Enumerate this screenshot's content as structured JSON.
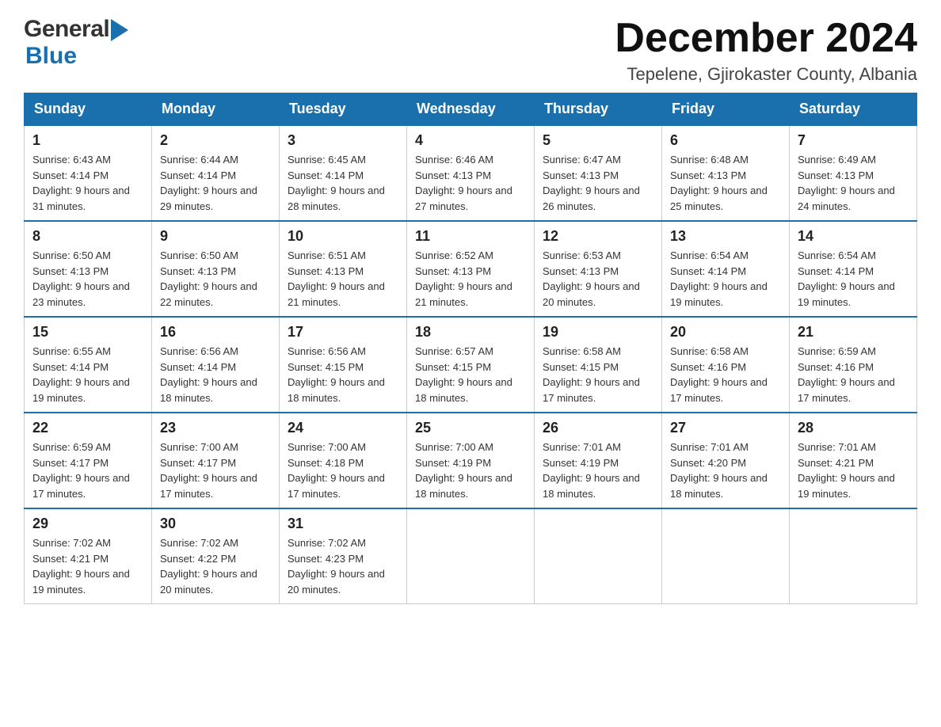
{
  "header": {
    "logo": {
      "general": "General",
      "blue": "Blue",
      "arrow_color": "#1a6fad"
    },
    "title": "December 2024",
    "location": "Tepelene, Gjirokaster County, Albania"
  },
  "calendar": {
    "days_of_week": [
      "Sunday",
      "Monday",
      "Tuesday",
      "Wednesday",
      "Thursday",
      "Friday",
      "Saturday"
    ],
    "weeks": [
      [
        {
          "day": "1",
          "sunrise": "Sunrise: 6:43 AM",
          "sunset": "Sunset: 4:14 PM",
          "daylight": "Daylight: 9 hours and 31 minutes."
        },
        {
          "day": "2",
          "sunrise": "Sunrise: 6:44 AM",
          "sunset": "Sunset: 4:14 PM",
          "daylight": "Daylight: 9 hours and 29 minutes."
        },
        {
          "day": "3",
          "sunrise": "Sunrise: 6:45 AM",
          "sunset": "Sunset: 4:14 PM",
          "daylight": "Daylight: 9 hours and 28 minutes."
        },
        {
          "day": "4",
          "sunrise": "Sunrise: 6:46 AM",
          "sunset": "Sunset: 4:13 PM",
          "daylight": "Daylight: 9 hours and 27 minutes."
        },
        {
          "day": "5",
          "sunrise": "Sunrise: 6:47 AM",
          "sunset": "Sunset: 4:13 PM",
          "daylight": "Daylight: 9 hours and 26 minutes."
        },
        {
          "day": "6",
          "sunrise": "Sunrise: 6:48 AM",
          "sunset": "Sunset: 4:13 PM",
          "daylight": "Daylight: 9 hours and 25 minutes."
        },
        {
          "day": "7",
          "sunrise": "Sunrise: 6:49 AM",
          "sunset": "Sunset: 4:13 PM",
          "daylight": "Daylight: 9 hours and 24 minutes."
        }
      ],
      [
        {
          "day": "8",
          "sunrise": "Sunrise: 6:50 AM",
          "sunset": "Sunset: 4:13 PM",
          "daylight": "Daylight: 9 hours and 23 minutes."
        },
        {
          "day": "9",
          "sunrise": "Sunrise: 6:50 AM",
          "sunset": "Sunset: 4:13 PM",
          "daylight": "Daylight: 9 hours and 22 minutes."
        },
        {
          "day": "10",
          "sunrise": "Sunrise: 6:51 AM",
          "sunset": "Sunset: 4:13 PM",
          "daylight": "Daylight: 9 hours and 21 minutes."
        },
        {
          "day": "11",
          "sunrise": "Sunrise: 6:52 AM",
          "sunset": "Sunset: 4:13 PM",
          "daylight": "Daylight: 9 hours and 21 minutes."
        },
        {
          "day": "12",
          "sunrise": "Sunrise: 6:53 AM",
          "sunset": "Sunset: 4:13 PM",
          "daylight": "Daylight: 9 hours and 20 minutes."
        },
        {
          "day": "13",
          "sunrise": "Sunrise: 6:54 AM",
          "sunset": "Sunset: 4:14 PM",
          "daylight": "Daylight: 9 hours and 19 minutes."
        },
        {
          "day": "14",
          "sunrise": "Sunrise: 6:54 AM",
          "sunset": "Sunset: 4:14 PM",
          "daylight": "Daylight: 9 hours and 19 minutes."
        }
      ],
      [
        {
          "day": "15",
          "sunrise": "Sunrise: 6:55 AM",
          "sunset": "Sunset: 4:14 PM",
          "daylight": "Daylight: 9 hours and 19 minutes."
        },
        {
          "day": "16",
          "sunrise": "Sunrise: 6:56 AM",
          "sunset": "Sunset: 4:14 PM",
          "daylight": "Daylight: 9 hours and 18 minutes."
        },
        {
          "day": "17",
          "sunrise": "Sunrise: 6:56 AM",
          "sunset": "Sunset: 4:15 PM",
          "daylight": "Daylight: 9 hours and 18 minutes."
        },
        {
          "day": "18",
          "sunrise": "Sunrise: 6:57 AM",
          "sunset": "Sunset: 4:15 PM",
          "daylight": "Daylight: 9 hours and 18 minutes."
        },
        {
          "day": "19",
          "sunrise": "Sunrise: 6:58 AM",
          "sunset": "Sunset: 4:15 PM",
          "daylight": "Daylight: 9 hours and 17 minutes."
        },
        {
          "day": "20",
          "sunrise": "Sunrise: 6:58 AM",
          "sunset": "Sunset: 4:16 PM",
          "daylight": "Daylight: 9 hours and 17 minutes."
        },
        {
          "day": "21",
          "sunrise": "Sunrise: 6:59 AM",
          "sunset": "Sunset: 4:16 PM",
          "daylight": "Daylight: 9 hours and 17 minutes."
        }
      ],
      [
        {
          "day": "22",
          "sunrise": "Sunrise: 6:59 AM",
          "sunset": "Sunset: 4:17 PM",
          "daylight": "Daylight: 9 hours and 17 minutes."
        },
        {
          "day": "23",
          "sunrise": "Sunrise: 7:00 AM",
          "sunset": "Sunset: 4:17 PM",
          "daylight": "Daylight: 9 hours and 17 minutes."
        },
        {
          "day": "24",
          "sunrise": "Sunrise: 7:00 AM",
          "sunset": "Sunset: 4:18 PM",
          "daylight": "Daylight: 9 hours and 17 minutes."
        },
        {
          "day": "25",
          "sunrise": "Sunrise: 7:00 AM",
          "sunset": "Sunset: 4:19 PM",
          "daylight": "Daylight: 9 hours and 18 minutes."
        },
        {
          "day": "26",
          "sunrise": "Sunrise: 7:01 AM",
          "sunset": "Sunset: 4:19 PM",
          "daylight": "Daylight: 9 hours and 18 minutes."
        },
        {
          "day": "27",
          "sunrise": "Sunrise: 7:01 AM",
          "sunset": "Sunset: 4:20 PM",
          "daylight": "Daylight: 9 hours and 18 minutes."
        },
        {
          "day": "28",
          "sunrise": "Sunrise: 7:01 AM",
          "sunset": "Sunset: 4:21 PM",
          "daylight": "Daylight: 9 hours and 19 minutes."
        }
      ],
      [
        {
          "day": "29",
          "sunrise": "Sunrise: 7:02 AM",
          "sunset": "Sunset: 4:21 PM",
          "daylight": "Daylight: 9 hours and 19 minutes."
        },
        {
          "day": "30",
          "sunrise": "Sunrise: 7:02 AM",
          "sunset": "Sunset: 4:22 PM",
          "daylight": "Daylight: 9 hours and 20 minutes."
        },
        {
          "day": "31",
          "sunrise": "Sunrise: 7:02 AM",
          "sunset": "Sunset: 4:23 PM",
          "daylight": "Daylight: 9 hours and 20 minutes."
        },
        null,
        null,
        null,
        null
      ]
    ]
  }
}
